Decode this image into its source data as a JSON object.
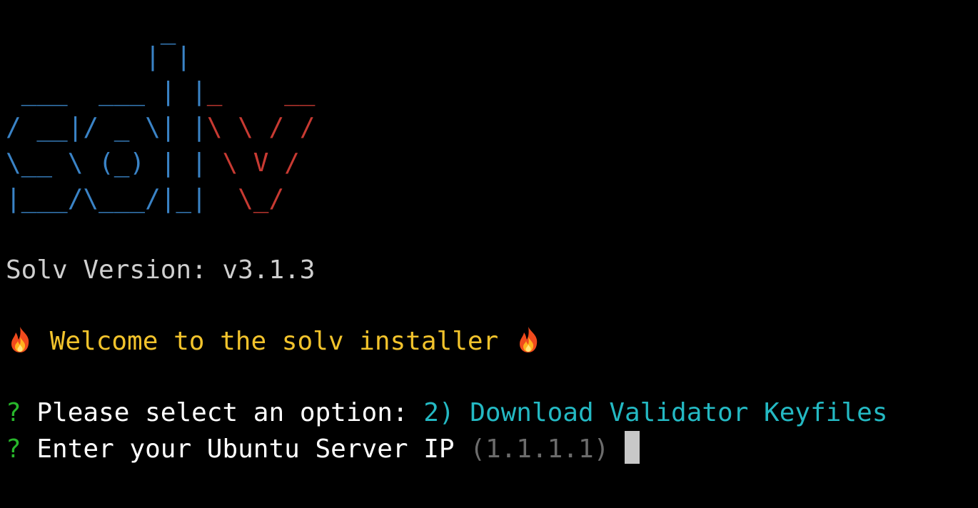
{
  "banner": {
    "lines": [
      {
        "blue": "          _",
        "red": ""
      },
      {
        "blue": "         | |",
        "red": ""
      },
      {
        "blue": " ___  ___ | |",
        "red": "_    __"
      },
      {
        "blue": "/ __|/ _ \\| |",
        "red": "\\ \\ / /"
      },
      {
        "blue": "\\__ \\ (_) | |",
        "red": " \\ V /"
      },
      {
        "blue": "|___/\\___/|_|",
        "red": "  \\_/"
      }
    ],
    "colors": {
      "blue": "#3a83c6",
      "red": "#c83a32"
    }
  },
  "version_line": "Solv Version: v3.1.3",
  "welcome": {
    "text": "Welcome to the solv installer",
    "icon": "fire-icon"
  },
  "prompts": [
    {
      "marker": "?",
      "question": "Please select an option:",
      "answer": "2) Download Validator Keyfiles"
    },
    {
      "marker": "?",
      "question": "Enter your Ubuntu Server IP",
      "default": "(1.1.1.1)"
    }
  ]
}
